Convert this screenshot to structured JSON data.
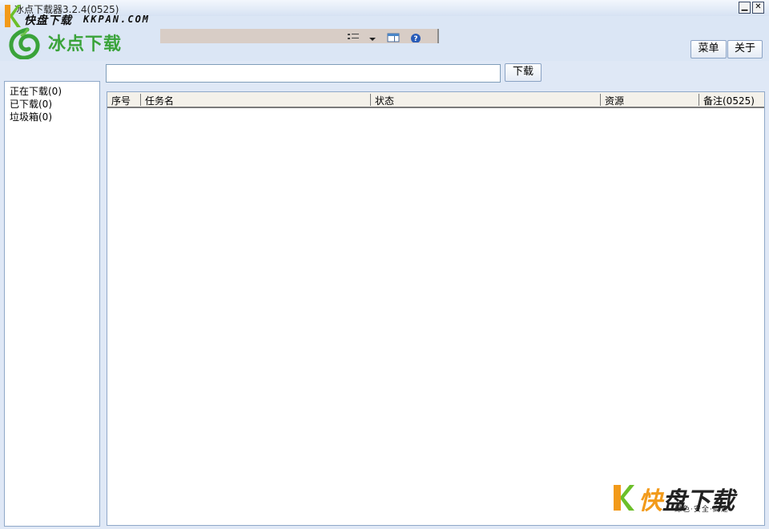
{
  "window": {
    "title": "冰点下载器3.2.4(0525)",
    "minimize_glyph": "▁",
    "close_glyph": "✕"
  },
  "watermark_top": {
    "brand": "快盘下载",
    "domain": "KKPAN.COM"
  },
  "header": {
    "logo_text": "冰点下载",
    "menu_button": "菜单",
    "about_button": "关于",
    "toolbar_icons": [
      "list-view-icon",
      "dropdown-arrow-icon",
      "window-icon",
      "help-icon"
    ]
  },
  "sidebar": {
    "items": [
      {
        "label": "正在下载(0)"
      },
      {
        "label": "已下载(0)"
      },
      {
        "label": "垃圾箱(0)"
      }
    ]
  },
  "url_bar": {
    "value": "",
    "download_button": "下载"
  },
  "table": {
    "columns": [
      "序号",
      "任务名",
      "状态",
      "资源",
      "备注(0525)"
    ],
    "rows": []
  },
  "watermark_bottom": {
    "title_k": "快",
    "title_rest": "盘下载",
    "subtitle": "绿色·安全·高速"
  },
  "colors": {
    "logo_green": "#3aa33a",
    "brand_orange": "#f29a1a",
    "background": "#dfe8f6"
  }
}
